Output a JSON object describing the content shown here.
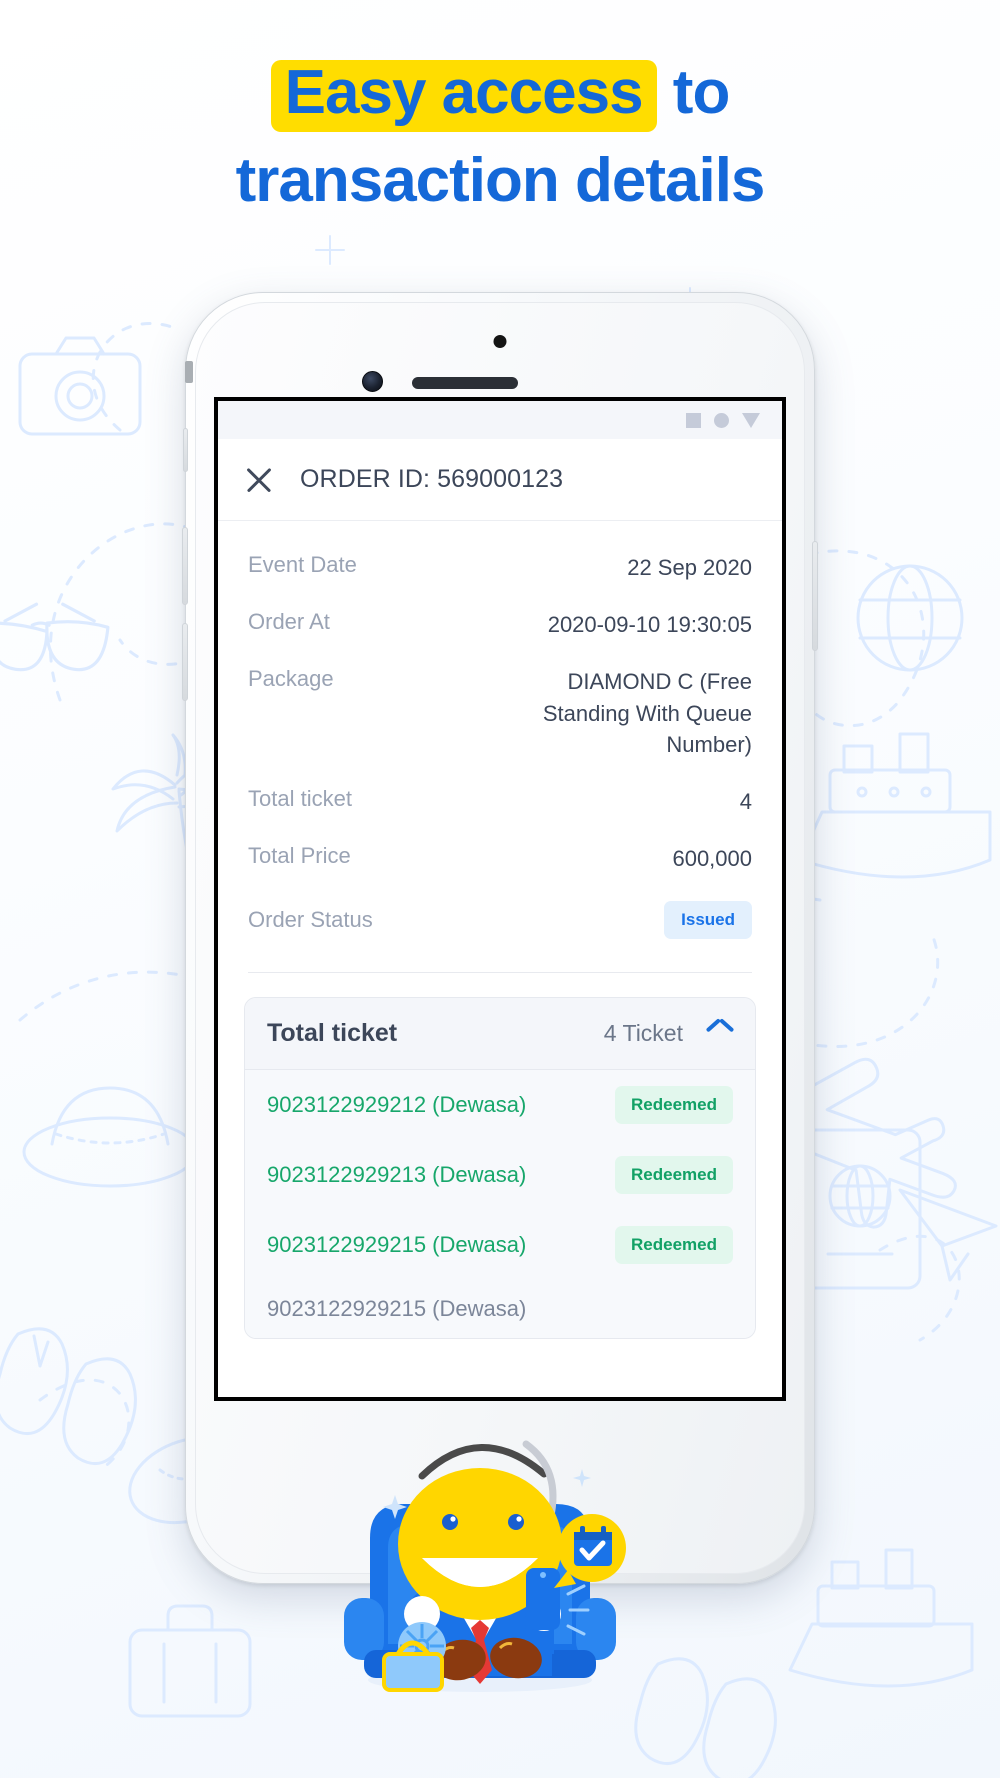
{
  "headline": {
    "highlighted": "Easy access",
    "after_highlight": " to",
    "line2": "transaction details",
    "highlight_color": "#ffdd00",
    "text_color": "#1468d8"
  },
  "phone": {
    "status_bar": {
      "icons": [
        "square-icon",
        "circle-icon",
        "triangle-down-icon"
      ]
    },
    "app_bar": {
      "close_icon": "close-icon",
      "title": "ORDER ID: 569000123"
    },
    "details": [
      {
        "label": "Event Date",
        "value": "22 Sep 2020"
      },
      {
        "label": "Order At",
        "value": "2020-09-10 19:30:05"
      },
      {
        "label": "Package",
        "value": "DIAMOND C (Free Standing With Queue Number)"
      },
      {
        "label": "Total ticket",
        "value": "4"
      },
      {
        "label": "Total Price",
        "value": "600,000"
      }
    ],
    "order_status": {
      "label": "Order Status",
      "badge": "Issued",
      "badge_bg": "#e3f0fd",
      "badge_fg": "#1a73e8"
    },
    "ticket_card": {
      "title": "Total ticket",
      "count": "4 Ticket",
      "toggle_icon": "chevron-up-icon",
      "rows": [
        {
          "id": "9023122929212 (Dewasa)",
          "status": "Redeemed",
          "redeemed": true
        },
        {
          "id": "9023122929213 (Dewasa)",
          "status": "Redeemed",
          "redeemed": true
        },
        {
          "id": "9023122929215 (Dewasa)",
          "status": "Redeemed",
          "redeemed": true
        },
        {
          "id": "9023122929215 (Dewasa)",
          "status": "",
          "redeemed": false
        }
      ],
      "redeemed_bg": "#e2f7ed",
      "redeemed_fg": "#12a166",
      "ticket_green": "#17a76b",
      "ticket_gray": "#7c8699"
    }
  },
  "mascot": {
    "name": "yellow-mascot-in-armchair",
    "body_color": "#ffd600",
    "chair_color": "#1a73e8",
    "bubble_icon": "calendar-check-icon"
  },
  "background": {
    "theme": "travel-doodles",
    "doodle_color": "#dbeaff"
  }
}
